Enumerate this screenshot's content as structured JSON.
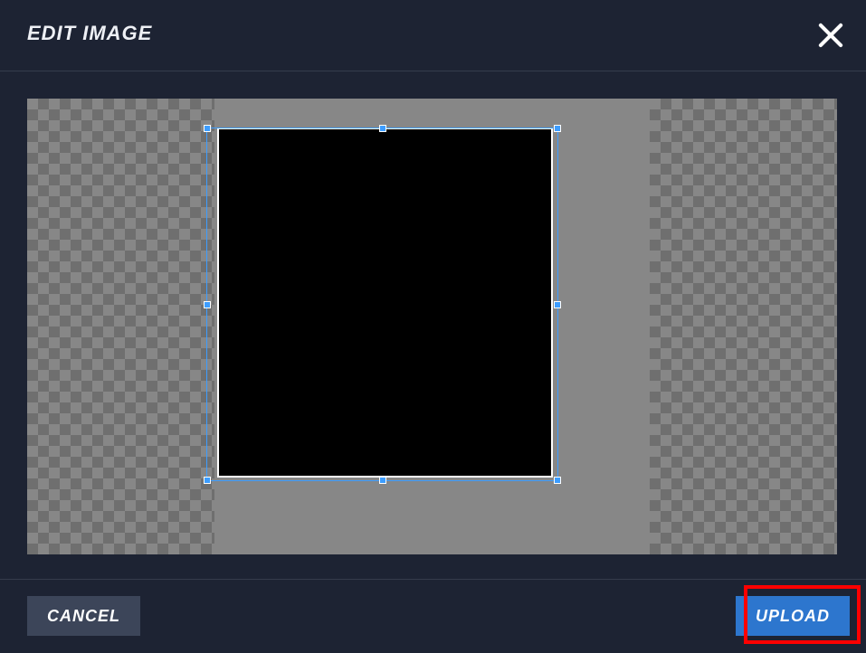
{
  "modal": {
    "title": "EDIT IMAGE"
  },
  "footer": {
    "cancel_label": "CANCEL",
    "upload_label": "UPLOAD"
  },
  "colors": {
    "accent": "#2d76ce",
    "highlight": "#ff0000",
    "crop_border": "#3d9dff"
  }
}
